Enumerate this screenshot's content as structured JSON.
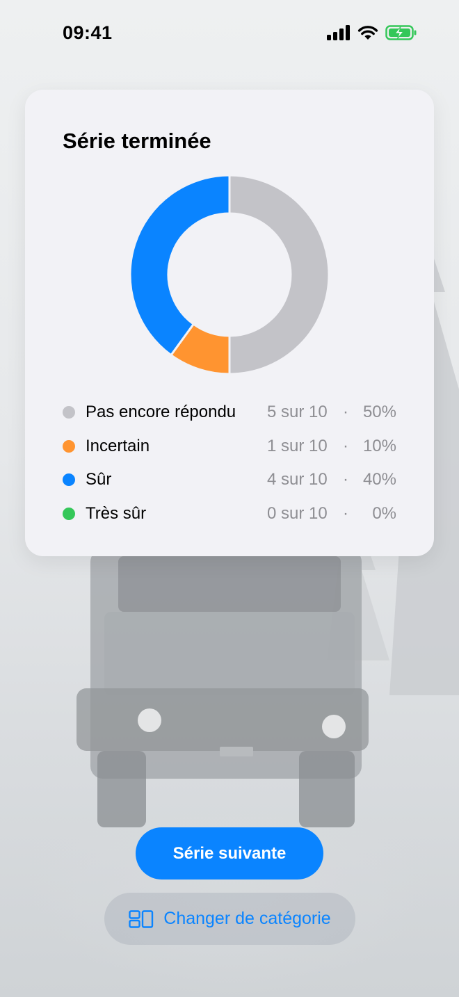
{
  "status_bar": {
    "time": "09:41"
  },
  "card": {
    "title": "Série terminée"
  },
  "chart_data": {
    "type": "pie",
    "variant": "donut",
    "categories": [
      "Pas encore répondu",
      "Incertain",
      "Sûr",
      "Très sûr"
    ],
    "values": [
      5,
      1,
      4,
      0
    ],
    "total": 10,
    "colors": [
      "#c3c3c8",
      "#ff9430",
      "#0a84ff",
      "#34c759"
    ]
  },
  "legend": [
    {
      "label": "Pas encore répondu",
      "count": "5 sur 10",
      "sep": "·",
      "pct": "50%",
      "color": "#c3c3c8"
    },
    {
      "label": "Incertain",
      "count": "1 sur 10",
      "sep": "·",
      "pct": "10%",
      "color": "#ff9430"
    },
    {
      "label": "Sûr",
      "count": "4 sur 10",
      "sep": "·",
      "pct": "40%",
      "color": "#0a84ff"
    },
    {
      "label": "Très sûr",
      "count": "0 sur 10",
      "sep": "·",
      "pct": "0%",
      "color": "#34c759"
    }
  ],
  "actions": {
    "next_label": "Série suivante",
    "change_category_label": "Changer de catégorie",
    "change_category_icon": "category-grid-icon",
    "accent": "#0a84ff"
  }
}
